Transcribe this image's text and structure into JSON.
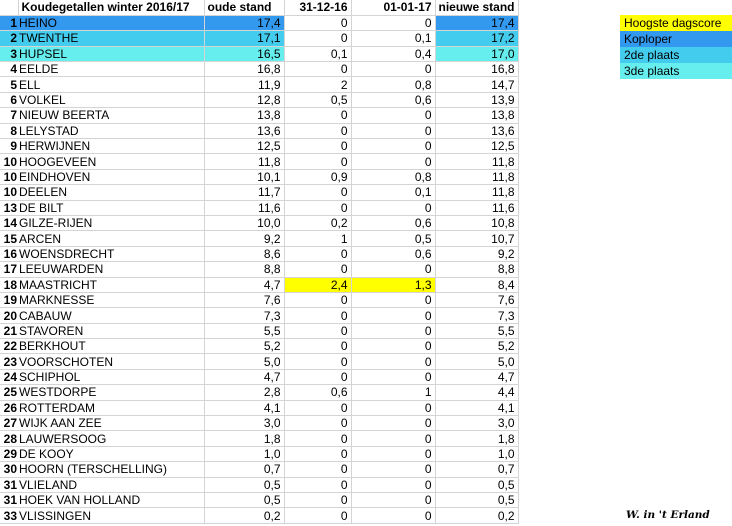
{
  "sheet": {
    "title": "Koudegetallen winter 2016/17",
    "headers": {
      "old": "oude stand",
      "d1": "31-12-16",
      "d2": "01-01-17",
      "new": "nieuwe stand"
    },
    "rows": [
      {
        "rank": "1",
        "name": "HEINO",
        "old": "17,4",
        "d1": "0",
        "d2": "0",
        "new": "17,4",
        "hl": "koploper",
        "hl_new": "koploper"
      },
      {
        "rank": "2",
        "name": "TWENTHE",
        "old": "17,1",
        "d1": "0",
        "d2": "0,1",
        "new": "17,2",
        "hl": "tweede",
        "hl_new": "tweede"
      },
      {
        "rank": "3",
        "name": "HUPSEL",
        "old": "16,5",
        "d1": "0,1",
        "d2": "0,4",
        "new": "17,0",
        "hl": "derde",
        "hl_new": "derde"
      },
      {
        "rank": "4",
        "name": "EELDE",
        "old": "16,8",
        "d1": "0",
        "d2": "0",
        "new": "16,8"
      },
      {
        "rank": "5",
        "name": "ELL",
        "old": "11,9",
        "d1": "2",
        "d2": "0,8",
        "new": "14,7"
      },
      {
        "rank": "6",
        "name": "VOLKEL",
        "old": "12,8",
        "d1": "0,5",
        "d2": "0,6",
        "new": "13,9"
      },
      {
        "rank": "7",
        "name": "NIEUW BEERTA",
        "old": "13,8",
        "d1": "0",
        "d2": "0",
        "new": "13,8"
      },
      {
        "rank": "8",
        "name": "LELYSTAD",
        "old": "13,6",
        "d1": "0",
        "d2": "0",
        "new": "13,6"
      },
      {
        "rank": "9",
        "name": "HERWIJNEN",
        "old": "12,5",
        "d1": "0",
        "d2": "0",
        "new": "12,5"
      },
      {
        "rank": "10",
        "name": "HOOGEVEEN",
        "old": "11,8",
        "d1": "0",
        "d2": "0",
        "new": "11,8"
      },
      {
        "rank": "10",
        "name": "EINDHOVEN",
        "old": "10,1",
        "d1": "0,9",
        "d2": "0,8",
        "new": "11,8"
      },
      {
        "rank": "10",
        "name": "DEELEN",
        "old": "11,7",
        "d1": "0",
        "d2": "0,1",
        "new": "11,8"
      },
      {
        "rank": "13",
        "name": "DE BILT",
        "old": "11,6",
        "d1": "0",
        "d2": "0",
        "new": "11,6"
      },
      {
        "rank": "14",
        "name": "GILZE-RIJEN",
        "old": "10,0",
        "d1": "0,2",
        "d2": "0,6",
        "new": "10,8"
      },
      {
        "rank": "15",
        "name": "ARCEN",
        "old": "9,2",
        "d1": "1",
        "d2": "0,5",
        "new": "10,7"
      },
      {
        "rank": "16",
        "name": "WOENSDRECHT",
        "old": "8,6",
        "d1": "0",
        "d2": "0,6",
        "new": "9,2"
      },
      {
        "rank": "17",
        "name": "LEEUWARDEN",
        "old": "8,8",
        "d1": "0",
        "d2": "0",
        "new": "8,8"
      },
      {
        "rank": "18",
        "name": "MAASTRICHT",
        "old": "4,7",
        "d1": "2,4",
        "d2": "1,3",
        "new": "8,4",
        "hl_day": "hoogste"
      },
      {
        "rank": "19",
        "name": "MARKNESSE",
        "old": "7,6",
        "d1": "0",
        "d2": "0",
        "new": "7,6"
      },
      {
        "rank": "20",
        "name": "CABAUW",
        "old": "7,3",
        "d1": "0",
        "d2": "0",
        "new": "7,3"
      },
      {
        "rank": "21",
        "name": "STAVOREN",
        "old": "5,5",
        "d1": "0",
        "d2": "0",
        "new": "5,5"
      },
      {
        "rank": "22",
        "name": "BERKHOUT",
        "old": "5,2",
        "d1": "0",
        "d2": "0",
        "new": "5,2"
      },
      {
        "rank": "23",
        "name": "VOORSCHOTEN",
        "old": "5,0",
        "d1": "0",
        "d2": "0",
        "new": "5,0"
      },
      {
        "rank": "24",
        "name": "SCHIPHOL",
        "old": "4,7",
        "d1": "0",
        "d2": "0",
        "new": "4,7"
      },
      {
        "rank": "25",
        "name": "WESTDORPE",
        "old": "2,8",
        "d1": "0,6",
        "d2": "1",
        "new": "4,4"
      },
      {
        "rank": "26",
        "name": "ROTTERDAM",
        "old": "4,1",
        "d1": "0",
        "d2": "0",
        "new": "4,1"
      },
      {
        "rank": "27",
        "name": "WIJK AAN ZEE",
        "old": "3,0",
        "d1": "0",
        "d2": "0",
        "new": "3,0"
      },
      {
        "rank": "28",
        "name": "LAUWERSOOG",
        "old": "1,8",
        "d1": "0",
        "d2": "0",
        "new": "1,8"
      },
      {
        "rank": "29",
        "name": "DE KOOY",
        "old": "1,0",
        "d1": "0",
        "d2": "0",
        "new": "1,0"
      },
      {
        "rank": "30",
        "name": "HOORN (TERSCHELLING)",
        "old": "0,7",
        "d1": "0",
        "d2": "0",
        "new": "0,7"
      },
      {
        "rank": "31",
        "name": "VLIELAND",
        "old": "0,5",
        "d1": "0",
        "d2": "0",
        "new": "0,5"
      },
      {
        "rank": "31",
        "name": "HOEK VAN HOLLAND",
        "old": "0,5",
        "d1": "0",
        "d2": "0",
        "new": "0,5"
      },
      {
        "rank": "33",
        "name": "VLISSINGEN",
        "old": "0,2",
        "d1": "0",
        "d2": "0",
        "new": "0,2"
      }
    ]
  },
  "legend": [
    {
      "key": "hoogste",
      "label": "Hoogste dagscore",
      "color": "#ffff00"
    },
    {
      "key": "koploper",
      "label": "Koploper",
      "color": "#3399ee"
    },
    {
      "key": "tweede",
      "label": "2de plaats",
      "color": "#44ccee"
    },
    {
      "key": "derde",
      "label": "3de plaats",
      "color": "#66eeee"
    }
  ],
  "colors": {
    "hoogste": "#ffff00",
    "koploper": "#3399ee",
    "tweede": "#44ccee",
    "derde": "#66eeee"
  },
  "credit": "W. in 't Erland"
}
